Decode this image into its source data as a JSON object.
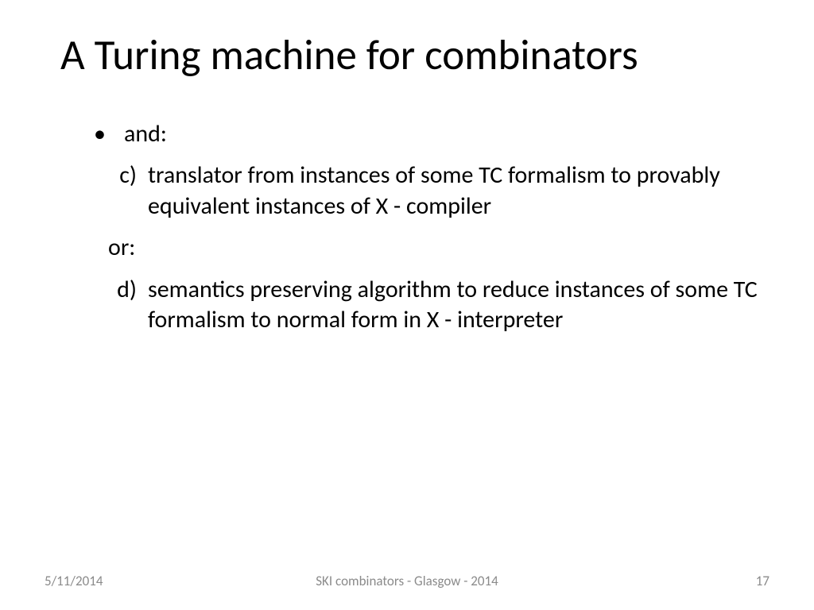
{
  "title": "A Turing machine for combinators",
  "body": {
    "lead": "and:",
    "item_c_marker": "c)",
    "item_c_text": "translator from instances of some TC formalism to provably equivalent  instances of X - compiler",
    "or": "or:",
    "item_d_marker": "d)",
    "item_d_text": "semantics preserving algorithm to reduce instances of some TC formalism to normal form in X - interpreter"
  },
  "footer": {
    "date": "5/11/2014",
    "center": "SKI combinators - Glasgow - 2014",
    "page": "17"
  }
}
